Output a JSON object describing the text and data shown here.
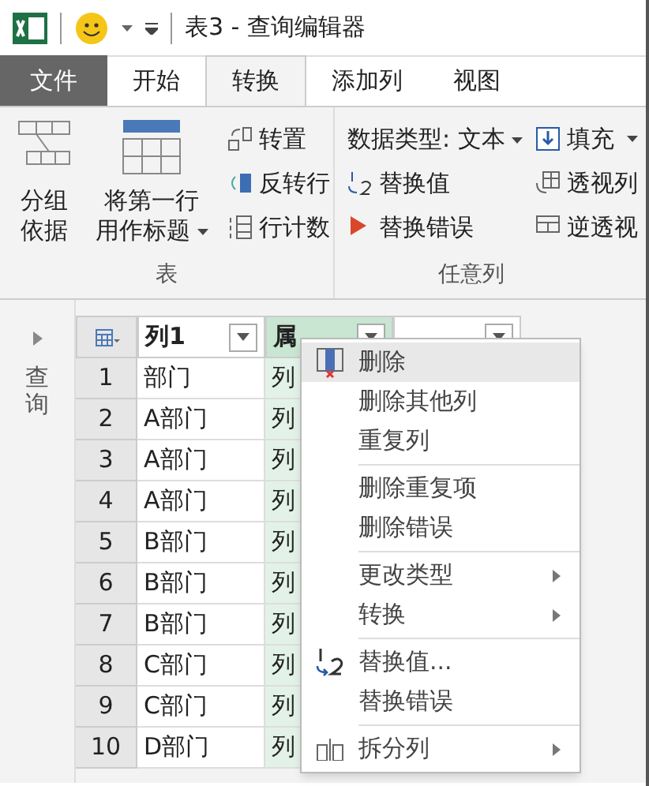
{
  "title_bar": {
    "title": "表3 - 查询编辑器"
  },
  "tabs": [
    {
      "label": "文件",
      "kind": "file",
      "selected": false
    },
    {
      "label": "开始",
      "kind": "tab",
      "selected": false
    },
    {
      "label": "转换",
      "kind": "tab",
      "selected": true
    },
    {
      "label": "添加列",
      "kind": "tab",
      "selected": false
    },
    {
      "label": "视图",
      "kind": "tab",
      "selected": false
    }
  ],
  "ribbon": {
    "table_group": {
      "label": "表",
      "group_by": [
        "分组",
        "依据"
      ],
      "use_first_row": [
        "将第一行",
        "用作标题"
      ],
      "small": [
        "转置",
        "反转行",
        "行计数"
      ]
    },
    "any_column_group": {
      "label": "任意列",
      "data_type": "数据类型: 文本",
      "replace_value": "替换值",
      "replace_errors": "替换错误",
      "fill": "填充",
      "pivot": "透视列",
      "unpivot": "逆透视"
    }
  },
  "query_pane": {
    "label": "查询"
  },
  "table": {
    "columns": [
      "列1",
      "属"
    ],
    "rows": [
      {
        "index": "1",
        "column_1": "部门",
        "column_2": "列"
      },
      {
        "index": "2",
        "column_1": "A部门",
        "column_2": "列"
      },
      {
        "index": "3",
        "column_1": "A部门",
        "column_2": "列"
      },
      {
        "index": "4",
        "column_1": "A部门",
        "column_2": "列"
      },
      {
        "index": "5",
        "column_1": "B部门",
        "column_2": "列"
      },
      {
        "index": "6",
        "column_1": "B部门",
        "column_2": "列"
      },
      {
        "index": "7",
        "column_1": "B部门",
        "column_2": "列"
      },
      {
        "index": "8",
        "column_1": "C部门",
        "column_2": "列"
      },
      {
        "index": "9",
        "column_1": "C部门",
        "column_2": "列"
      },
      {
        "index": "10",
        "column_1": "D部门",
        "column_2": "列"
      }
    ]
  },
  "context_menu": [
    {
      "kind": "delete",
      "label": "删除",
      "selected": true,
      "submenu": false
    },
    {
      "kind": "plain",
      "label": "删除其他列",
      "selected": false,
      "submenu": false
    },
    {
      "kind": "plain",
      "label": "重复列",
      "selected": false,
      "submenu": false
    },
    {
      "kind": "separator"
    },
    {
      "kind": "plain",
      "label": "删除重复项",
      "selected": false,
      "submenu": false
    },
    {
      "kind": "plain",
      "label": "删除错误",
      "selected": false,
      "submenu": false
    },
    {
      "kind": "separator"
    },
    {
      "kind": "plain",
      "label": "更改类型",
      "selected": false,
      "submenu": true
    },
    {
      "kind": "plain",
      "label": "转换",
      "selected": false,
      "submenu": true
    },
    {
      "kind": "separator"
    },
    {
      "kind": "replace",
      "label": "替换值...",
      "selected": false,
      "submenu": false
    },
    {
      "kind": "plain",
      "label": "替换错误",
      "selected": false,
      "submenu": false
    },
    {
      "kind": "separator"
    },
    {
      "kind": "split",
      "label": "拆分列",
      "selected": false,
      "submenu": true
    }
  ]
}
